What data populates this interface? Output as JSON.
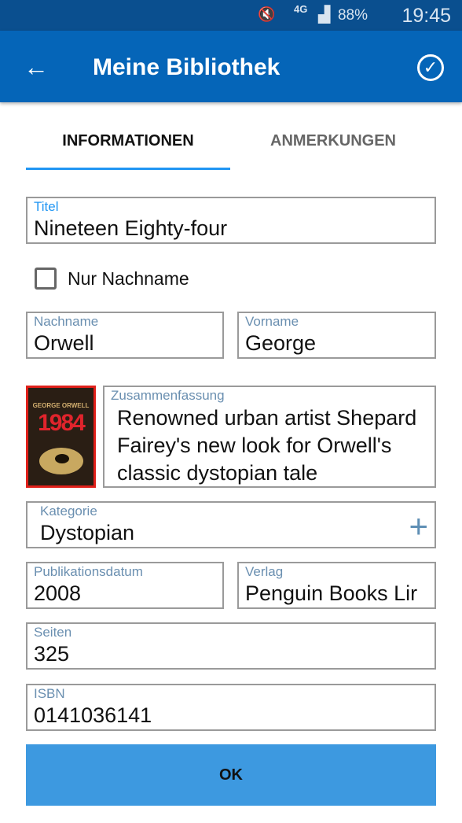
{
  "status_bar": {
    "battery": "88%",
    "network": "4G",
    "time": "19:45"
  },
  "app_bar": {
    "title": "Meine Bibliothek"
  },
  "tabs": [
    {
      "label": "INFORMATIONEN",
      "active": true
    },
    {
      "label": "ANMERKUNGEN",
      "active": false
    }
  ],
  "form": {
    "title": {
      "label": "Titel",
      "value": "Nineteen Eighty-four"
    },
    "surname_only": {
      "label": "Nur Nachname",
      "checked": false
    },
    "last_name": {
      "label": "Nachname",
      "value": "Orwell"
    },
    "first_name": {
      "label": "Vorname",
      "value": "George"
    },
    "cover": {
      "author": "GEORGE ORWELL",
      "title": "1984"
    },
    "summary": {
      "label": "Zusammenfassung",
      "value": "Renowned urban artist Shepard Fairey's new look for Orwell's classic dystopian tale"
    },
    "category": {
      "label": "Kategorie",
      "value": "Dystopian"
    },
    "pub_date": {
      "label": "Publikationsdatum",
      "value": "2008"
    },
    "publisher": {
      "label": "Verlag",
      "value": "Penguin Books Lir"
    },
    "pages": {
      "label": "Seiten",
      "value": "325"
    },
    "isbn": {
      "label": "ISBN",
      "value": "0141036141"
    }
  },
  "ok_label": "OK",
  "colors": {
    "status": "#0a4f8f",
    "appbar": "#0565b8",
    "accent": "#2196f3",
    "button": "#3d99e0"
  }
}
